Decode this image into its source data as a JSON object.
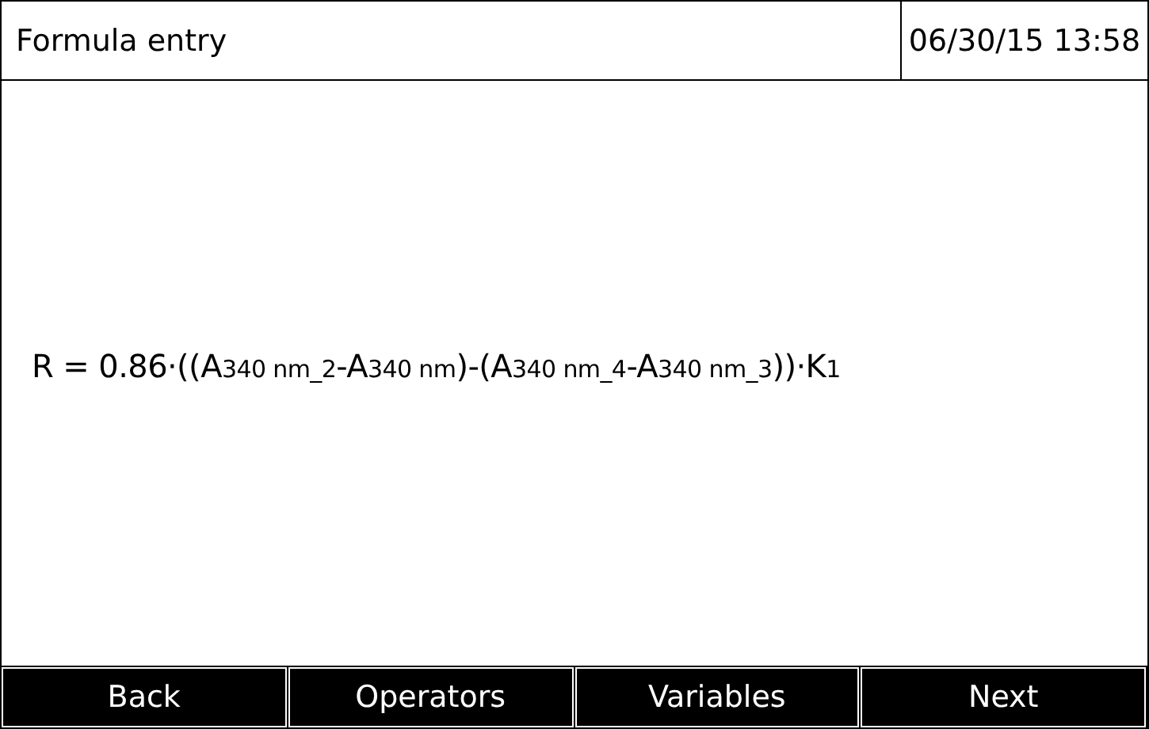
{
  "header": {
    "title": "Formula entry",
    "datetime": "06/30/15 13:58"
  },
  "formula": "R = 0.86·((A$_{340 nm_2}$-A$_{340 nm}$)-(A$_{340 nm_4}$-A$_{340 nm_3}$))·K$_{1}$",
  "buttons": [
    "Back",
    "Operators",
    "Variables",
    "Next"
  ]
}
